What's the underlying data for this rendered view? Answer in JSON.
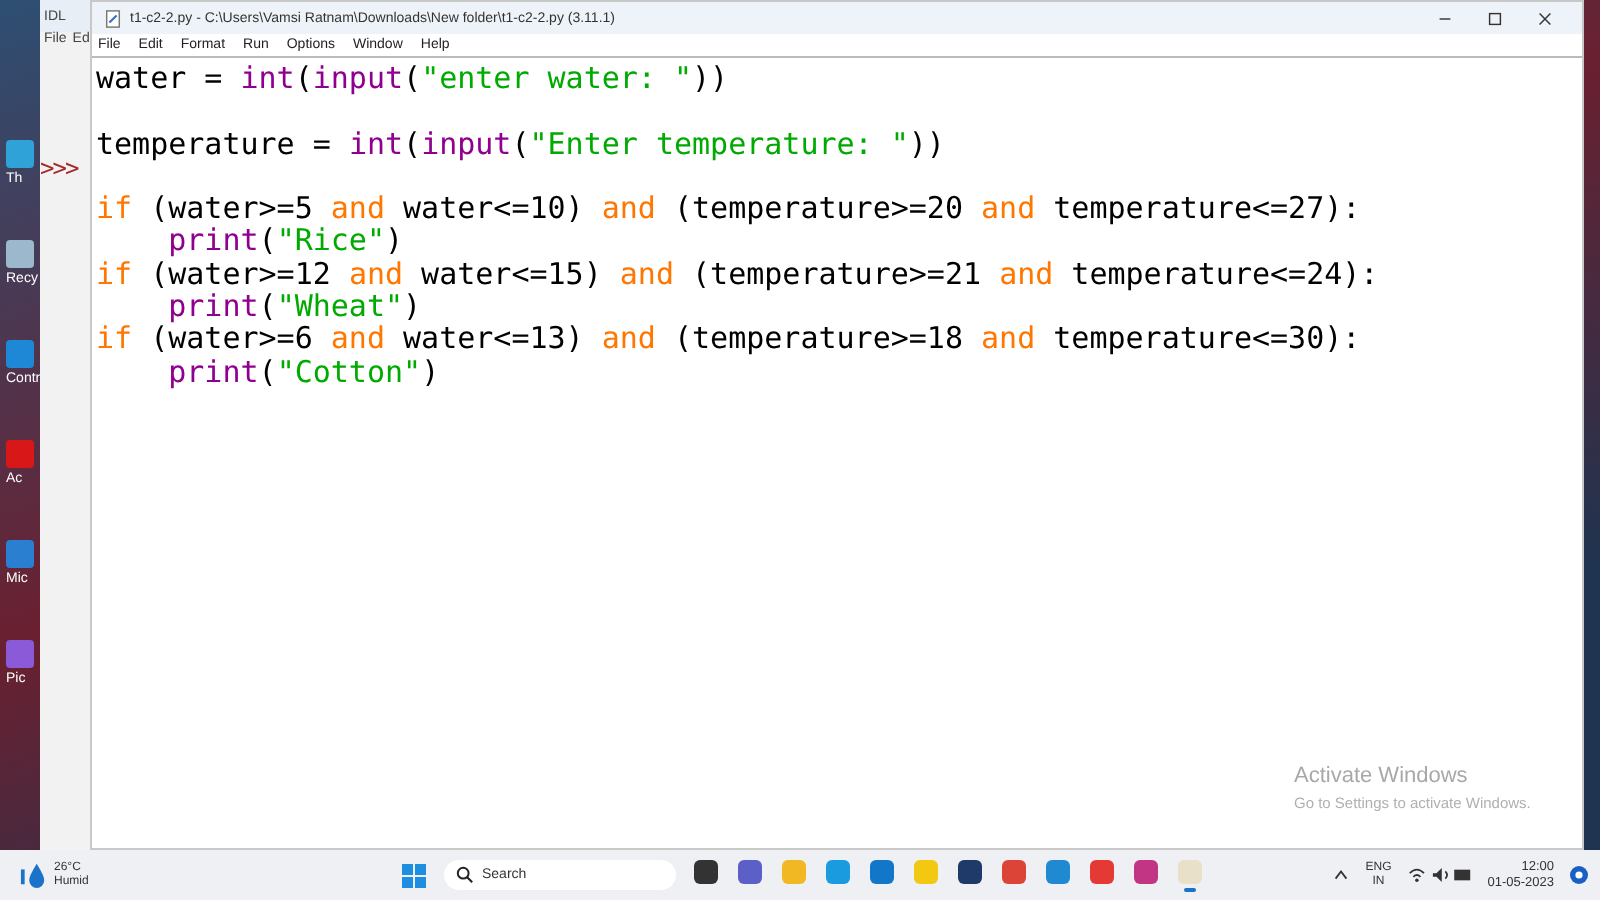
{
  "desktop": {
    "icons": [
      {
        "label": "Th",
        "color": "#2fa3d8"
      },
      {
        "label": "Recy",
        "color": "#9bb8cc"
      },
      {
        "label": "Contr",
        "color": "#1e88d6"
      },
      {
        "label": "Ac",
        "color": "#d81818"
      },
      {
        "label": "Mic",
        "color": "#2a7fd0"
      },
      {
        "label": "Pic",
        "color": "#8a5ad8"
      }
    ]
  },
  "back_window": {
    "title": "IDL",
    "menu": [
      "File",
      "Ed"
    ],
    "prompt": ">>>"
  },
  "window": {
    "title": "t1-c2-2.py - C:\\Users\\Vamsi Ratnam\\Downloads\\New folder\\t1-c2-2.py (3.11.1)",
    "menu": [
      "File",
      "Edit",
      "Format",
      "Run",
      "Options",
      "Window",
      "Help"
    ]
  },
  "editor": {
    "lines": [
      {
        "kind": "code",
        "tokens": [
          {
            "text": "water = ",
            "kind": "plain"
          },
          {
            "text": "int",
            "kind": "builtin"
          },
          {
            "text": "(",
            "kind": "plain"
          },
          {
            "text": "input",
            "kind": "builtin"
          },
          {
            "text": "(",
            "kind": "plain"
          },
          {
            "text": "\"enter water: \"",
            "kind": "string"
          },
          {
            "text": "))",
            "kind": "plain"
          }
        ]
      },
      {
        "kind": "blank"
      },
      {
        "kind": "code",
        "tokens": [
          {
            "text": "temperature = ",
            "kind": "plain"
          },
          {
            "text": "int",
            "kind": "builtin"
          },
          {
            "text": "(",
            "kind": "plain"
          },
          {
            "text": "input",
            "kind": "builtin"
          },
          {
            "text": "(",
            "kind": "plain"
          },
          {
            "text": "\"Enter temperature: \"",
            "kind": "string"
          },
          {
            "text": "))",
            "kind": "plain"
          }
        ]
      },
      {
        "kind": "blank"
      },
      {
        "kind": "code",
        "tokens": [
          {
            "text": "if",
            "kind": "keyword"
          },
          {
            "text": " (water>=5 ",
            "kind": "plain"
          },
          {
            "text": "and",
            "kind": "keyword"
          },
          {
            "text": " water<=10) ",
            "kind": "plain"
          },
          {
            "text": "and",
            "kind": "keyword"
          },
          {
            "text": " (temperature>=20 ",
            "kind": "plain"
          },
          {
            "text": "and",
            "kind": "keyword"
          },
          {
            "text": " temperature<=27):",
            "kind": "plain"
          }
        ]
      },
      {
        "kind": "code",
        "tokens": [
          {
            "text": "    print",
            "kind": "builtin"
          },
          {
            "text": "(",
            "kind": "plain"
          },
          {
            "text": "\"Rice\"",
            "kind": "string"
          },
          {
            "text": ")",
            "kind": "plain"
          }
        ]
      },
      {
        "kind": "code",
        "tokens": [
          {
            "text": "if",
            "kind": "keyword"
          },
          {
            "text": " (water>=12 ",
            "kind": "plain"
          },
          {
            "text": "and",
            "kind": "keyword"
          },
          {
            "text": " water<=15) ",
            "kind": "plain"
          },
          {
            "text": "and",
            "kind": "keyword"
          },
          {
            "text": " (temperature>=21 ",
            "kind": "plain"
          },
          {
            "text": "and",
            "kind": "keyword"
          },
          {
            "text": " temperature<=24):",
            "kind": "plain"
          }
        ]
      },
      {
        "kind": "code",
        "tokens": [
          {
            "text": "    print",
            "kind": "builtin"
          },
          {
            "text": "(",
            "kind": "plain"
          },
          {
            "text": "\"Wheat\"",
            "kind": "string"
          },
          {
            "text": ")",
            "kind": "plain"
          }
        ]
      },
      {
        "kind": "code",
        "tokens": [
          {
            "text": "if",
            "kind": "keyword"
          },
          {
            "text": " (water>=6 ",
            "kind": "plain"
          },
          {
            "text": "and",
            "kind": "keyword"
          },
          {
            "text": " water<=13) ",
            "kind": "plain"
          },
          {
            "text": "and",
            "kind": "keyword"
          },
          {
            "text": " (temperature>=18 ",
            "kind": "plain"
          },
          {
            "text": "and",
            "kind": "keyword"
          },
          {
            "text": " temperature<=30):",
            "kind": "plain"
          }
        ]
      },
      {
        "kind": "code",
        "tokens": [
          {
            "text": "    print",
            "kind": "builtin"
          },
          {
            "text": "(",
            "kind": "plain"
          },
          {
            "text": "\"Cotton\"",
            "kind": "string"
          },
          {
            "text": ")",
            "kind": "plain"
          }
        ]
      }
    ]
  },
  "activation_notice": {
    "title": "Activate Windows",
    "subtitle": "Go to Settings to activate Windows."
  },
  "taskbar": {
    "weather": {
      "temperature": "26°C",
      "condition": "Humid"
    },
    "search": {
      "placeholder": "Search"
    },
    "apps": [
      {
        "kind": "files",
        "active": false
      },
      {
        "kind": "chat",
        "active": false
      },
      {
        "kind": "folder",
        "active": false
      },
      {
        "kind": "edge",
        "active": false
      },
      {
        "kind": "mail",
        "active": false
      },
      {
        "kind": "powerbi",
        "active": false
      },
      {
        "kind": "dev",
        "active": false
      },
      {
        "kind": "chrome",
        "active": false
      },
      {
        "kind": "vscode",
        "active": false
      },
      {
        "kind": "red",
        "active": false
      },
      {
        "kind": "instagram",
        "active": false
      },
      {
        "kind": "idle",
        "active": true
      }
    ],
    "tray": {
      "language": "ENG",
      "region": "IN",
      "time": "12:00",
      "date": "01-05-2023"
    }
  }
}
